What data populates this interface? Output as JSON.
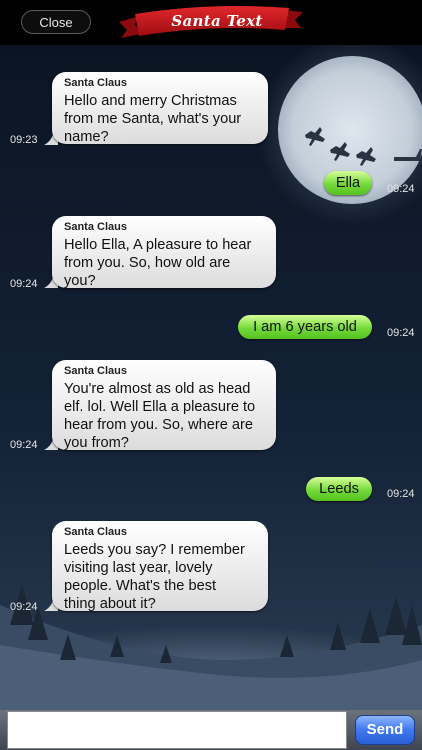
{
  "header": {
    "close_label": "Close",
    "title": "Santa Text"
  },
  "messages": [
    {
      "from": "santa",
      "sender": "Santa Claus",
      "lines": [
        "Hello and merry Christmas",
        "from me Santa, what's your",
        "name?"
      ],
      "time": "09:23"
    },
    {
      "from": "user",
      "text": "Ella",
      "time": "09:24"
    },
    {
      "from": "santa",
      "sender": "Santa Claus",
      "lines": [
        "Hello Ella, A pleasure to hear",
        "from you. So, how old are",
        "you?"
      ],
      "time": "09:24"
    },
    {
      "from": "user",
      "text": "I am 6 years old",
      "time": "09:24"
    },
    {
      "from": "santa",
      "sender": "Santa Claus",
      "lines": [
        "You're almost as old as head",
        "elf. lol. Well Ella a pleasure to",
        "hear from you. So, where are",
        "you from?"
      ],
      "time": "09:24"
    },
    {
      "from": "user",
      "text": "Leeds",
      "time": "09:24"
    },
    {
      "from": "santa",
      "sender": "Santa Claus",
      "lines": [
        "Leeds you say? I remember",
        "visiting last year, lovely",
        "people. What's the best",
        "thing about it?"
      ],
      "time": "09:24"
    }
  ],
  "composer": {
    "input_value": "",
    "send_label": "Send"
  },
  "colors": {
    "incoming_bubble": "#ececec",
    "outgoing_bubble": "#7ad63f",
    "send_button": "#3d78ee"
  }
}
